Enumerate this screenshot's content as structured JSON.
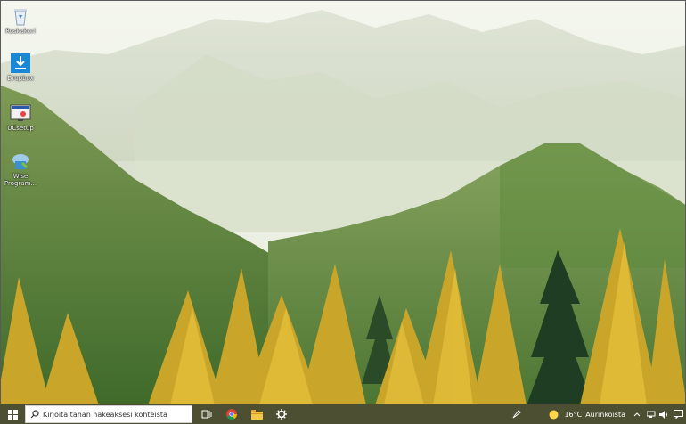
{
  "desktop": {
    "icons": [
      {
        "label": "Roskakori",
        "icon": "recycle-bin-icon"
      },
      {
        "label": "Dropbox",
        "icon": "download-icon"
      },
      {
        "label": "UCsetup",
        "icon": "installer-icon"
      },
      {
        "label": "Wise Program...",
        "icon": "wise-program-icon"
      }
    ]
  },
  "taskbar": {
    "search_placeholder": "Kirjoita tähän hakeaksesi kohteista",
    "weather": {
      "temp": "16°C",
      "condition": "Aurinkoista"
    }
  },
  "colors": {
    "taskbar": "#4c4f31",
    "accent": "#ffd54a"
  }
}
